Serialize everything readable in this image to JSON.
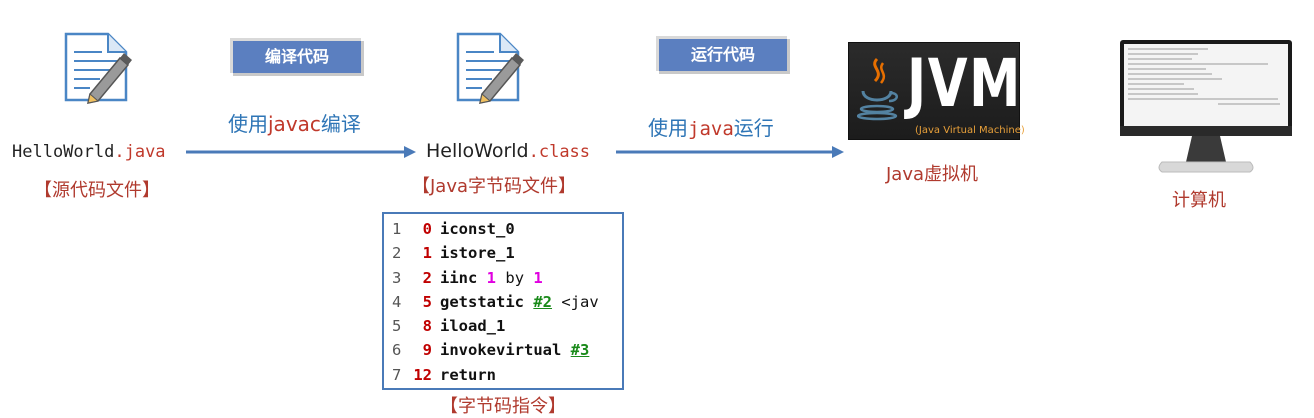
{
  "source_file": {
    "base": "HelloWorld",
    "ext": ".java",
    "caption": "【源代码文件】"
  },
  "class_file": {
    "base": "HelloWorld",
    "ext": ".class",
    "caption": "【Java字节码文件】"
  },
  "step_compile": {
    "badge": "编译代码",
    "caption_pre": "使用",
    "caption_hl": "javac",
    "caption_post": "编译"
  },
  "step_run": {
    "badge": "运行代码",
    "caption_pre": "使用",
    "caption_hl": "java",
    "caption_post": "运行"
  },
  "jvm": {
    "logo_text": "JVM",
    "logo_subtitle": "(Java Virtual Machine)",
    "caption": "Java虚拟机"
  },
  "computer": {
    "caption": "计算机"
  },
  "bytecode": {
    "caption": "【字节码指令】",
    "lines": [
      {
        "ln": "1",
        "offset": "0",
        "op": "iconst_0"
      },
      {
        "ln": "2",
        "offset": "1",
        "op": "istore_1"
      },
      {
        "ln": "3",
        "offset": "2",
        "op": "iinc",
        "a": "1",
        "kw": "by",
        "b": "1"
      },
      {
        "ln": "4",
        "offset": "5",
        "op": "getstatic",
        "ref": "#2",
        "tail": "<jav"
      },
      {
        "ln": "5",
        "offset": "8",
        "op": "iload_1"
      },
      {
        "ln": "6",
        "offset": "9",
        "op": "invokevirtual",
        "ref": "#3"
      },
      {
        "ln": "7",
        "offset": "12",
        "op": "return"
      }
    ]
  },
  "colors": {
    "badge_bg": "#5b7fc0",
    "arrow": "#4a7ab8",
    "caption_red": "#b03a2e",
    "caption_blue": "#2e75b6"
  }
}
